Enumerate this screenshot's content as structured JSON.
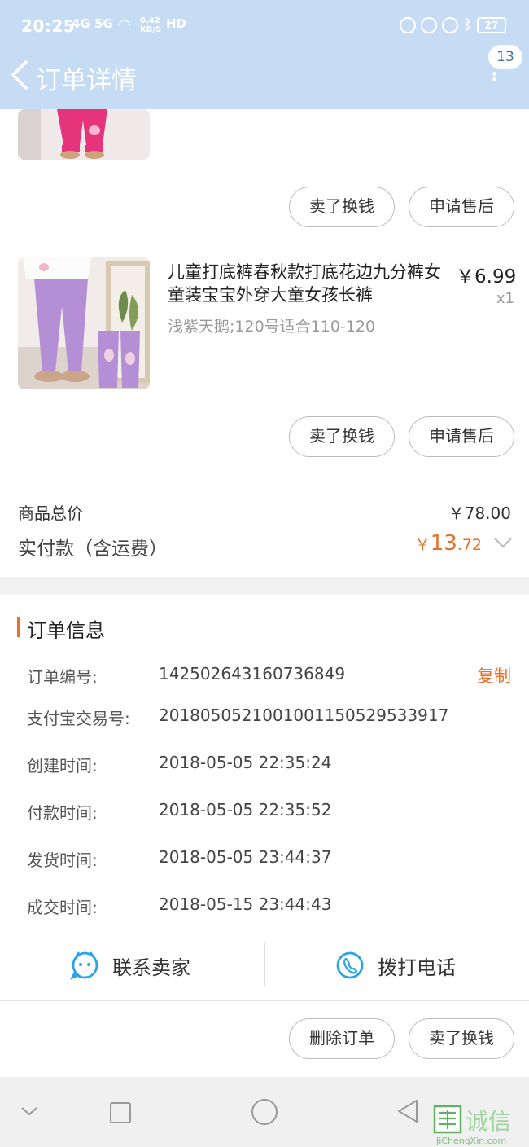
{
  "status_bar": {
    "time": "20:25",
    "signal": "4G 5G",
    "speed": "0.42 KB/S",
    "hd": "HD",
    "battery": "27"
  },
  "header": {
    "title": "订单详情",
    "badge": "13"
  },
  "items": [
    {
      "buttons": [
        "卖了换钱",
        "申请售后"
      ]
    },
    {
      "title": "儿童打底裤春秋款打底花边九分裤女童装宝宝外穿大童女孩长裤",
      "price": "￥6.99",
      "qty": "x1",
      "sku": "浅紫天鹅;120号适合110-120",
      "buttons": [
        "卖了换钱",
        "申请售后"
      ]
    }
  ],
  "summary": {
    "total_label": "商品总价",
    "total_value": "￥78.00",
    "paid_label": "实付款（含运费）",
    "paid_currency": "￥",
    "paid_int": "13",
    "paid_dec": ".72"
  },
  "order_info": {
    "title": "订单信息",
    "copy": "复制",
    "rows": [
      {
        "k": "订单编号:",
        "v": "142502643160736849"
      },
      {
        "k": "支付宝交易号:",
        "v": "2018050521001001150529533917"
      },
      {
        "k": "创建时间:",
        "v": "2018-05-05 22:35:24"
      },
      {
        "k": "付款时间:",
        "v": "2018-05-05 22:35:52"
      },
      {
        "k": "发货时间:",
        "v": "2018-05-05 23:44:37"
      },
      {
        "k": "成交时间:",
        "v": "2018-05-15 23:44:43"
      }
    ]
  },
  "contact": {
    "seller": "联系卖家",
    "call": "拨打电话"
  },
  "footer_buttons": [
    "删除订单",
    "卖了换钱"
  ],
  "watermark": {
    "cn": "诚信",
    "en": "JiChengXin.com"
  },
  "colors": {
    "header_bg": "#c6dcf5",
    "accent": "#e8702a",
    "icon_blue": "#2ba3e6"
  }
}
